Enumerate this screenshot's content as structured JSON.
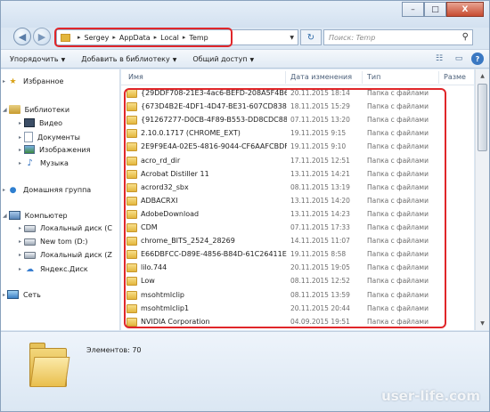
{
  "window": {
    "buttons": {
      "minimize": "–",
      "maximize": "□",
      "close": "X"
    }
  },
  "address": {
    "crumbs": [
      "Sergey",
      "AppData",
      "Local",
      "Temp"
    ],
    "search_placeholder": "Поиск: Temp"
  },
  "toolbar": {
    "organize": "Упорядочить",
    "add_library": "Добавить в библиотеку",
    "share": "Общий доступ",
    "help": "?"
  },
  "sidebar": {
    "favorites": "Избранное",
    "libraries": "Библиотеки",
    "video": "Видео",
    "documents": "Документы",
    "images": "Изображения",
    "music": "Музыка",
    "homegroup": "Домашняя группа",
    "computer": "Компьютер",
    "drive_c": "Локальный диск (C",
    "drive_d": "New tom (D:)",
    "drive_z": "Локальный диск (Z",
    "yandex": "Яндекс.Диск",
    "network": "Сеть"
  },
  "columns": {
    "name": "Имя",
    "date": "Дата изменения",
    "type": "Тип",
    "size": "Разме"
  },
  "files": [
    {
      "name": "{29DDF708-21E3-4ac6-BEFD-208A5F4B6B...",
      "date": "20.11.2015 18:14",
      "type": "Папка с файлами"
    },
    {
      "name": "{673D4B2E-4DF1-4D47-BE31-607CD83833...",
      "date": "18.11.2015 15:29",
      "type": "Папка с файлами"
    },
    {
      "name": "{91267277-D0CB-4F89-B553-DD8CDC884...",
      "date": "07.11.2015 13:20",
      "type": "Папка с файлами"
    },
    {
      "name": "2.10.0.1717 (CHROME_EXT)",
      "date": "19.11.2015 9:15",
      "type": "Папка с файлами"
    },
    {
      "name": "2E9F9E4A-02E5-4816-9044-CF6AAFCBDF8B",
      "date": "19.11.2015 9:10",
      "type": "Папка с файлами"
    },
    {
      "name": "acro_rd_dir",
      "date": "17.11.2015 12:51",
      "type": "Папка с файлами"
    },
    {
      "name": "Acrobat Distiller 11",
      "date": "13.11.2015 14:21",
      "type": "Папка с файлами"
    },
    {
      "name": "acrord32_sbx",
      "date": "08.11.2015 13:19",
      "type": "Папка с файлами"
    },
    {
      "name": "ADBACRXI",
      "date": "13.11.2015 14:20",
      "type": "Папка с файлами"
    },
    {
      "name": "AdobeDownload",
      "date": "13.11.2015 14:23",
      "type": "Папка с файлами"
    },
    {
      "name": "CDM",
      "date": "07.11.2015 17:33",
      "type": "Папка с файлами"
    },
    {
      "name": "chrome_BITS_2524_28269",
      "date": "14.11.2015 11:07",
      "type": "Папка с файлами"
    },
    {
      "name": "E66DBFCC-D89E-4856-B84D-61C26411E03E",
      "date": "19.11.2015 8:58",
      "type": "Папка с файлами"
    },
    {
      "name": "lilo.744",
      "date": "20.11.2015 19:05",
      "type": "Папка с файлами"
    },
    {
      "name": "Low",
      "date": "08.11.2015 12:52",
      "type": "Папка с файлами"
    },
    {
      "name": "msohtmlclip",
      "date": "08.11.2015 13:59",
      "type": "Папка с файлами"
    },
    {
      "name": "msohtmlclip1",
      "date": "20.11.2015 20:44",
      "type": "Папка с файлами"
    },
    {
      "name": "NVIDIA Corporation",
      "date": "04.09.2015 19:51",
      "type": "Папка с файлами"
    }
  ],
  "details": {
    "count_label": "Элементов: 70"
  },
  "watermark": "user-life.com",
  "colors": {
    "highlight": "#e0262a",
    "chrome": "#dbe7f3",
    "folder": "#e3b63d"
  }
}
